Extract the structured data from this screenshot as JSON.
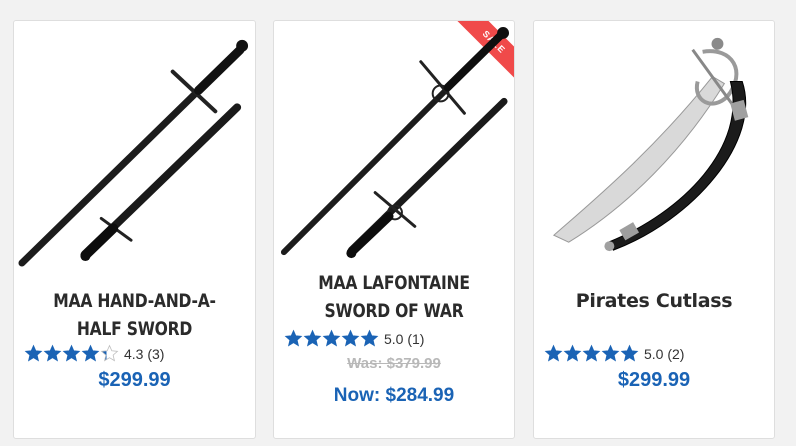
{
  "colors": {
    "accent": "#1a63b5",
    "star": "#1a63b5",
    "sale_ribbon": "#f04a4a",
    "was_price": "#b8b8b8"
  },
  "products": [
    {
      "title": "MAA HAND-AND-A-HALF SWORD",
      "image": "hand-and-a-half-sword-image",
      "rating": 4.3,
      "rating_text": "4.3 (3)",
      "price": "$299.99"
    },
    {
      "title": "MAA LAFONTAINE SWORD OF WAR",
      "image": "lafontaine-sword-image",
      "badge": "SALE",
      "rating": 5.0,
      "rating_text": "5.0 (1)",
      "was_price": "Was: $379.99",
      "now_price": "Now: $284.99"
    },
    {
      "title": "Pirates Cutlass",
      "image": "pirates-cutlass-image",
      "rating": 5.0,
      "rating_text": "5.0 (2)",
      "price": "$299.99"
    }
  ]
}
